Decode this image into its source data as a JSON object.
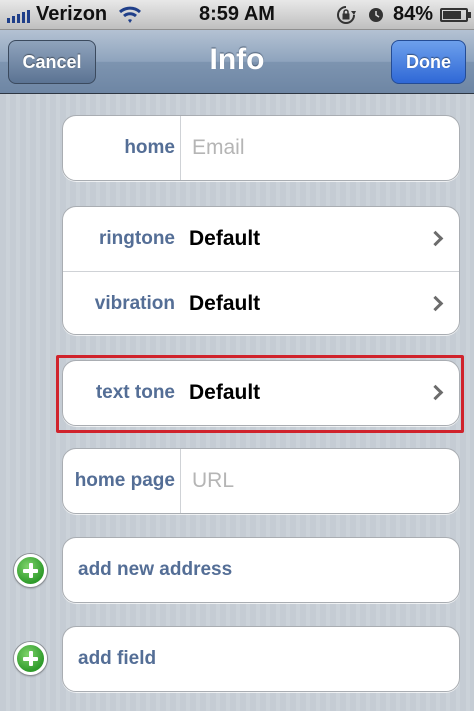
{
  "status_bar": {
    "carrier": "Verizon",
    "time": "8:59 AM",
    "battery_percent": "84%",
    "battery_level": 0.84,
    "icons": [
      "signal-icon",
      "wifi-icon",
      "rotation-lock-icon",
      "alarm-icon",
      "battery-icon"
    ]
  },
  "nav": {
    "title": "Info",
    "cancel_label": "Cancel",
    "done_label": "Done"
  },
  "email": {
    "label": "home",
    "placeholder": "Email"
  },
  "sounds": {
    "ringtone_label": "ringtone",
    "ringtone_value": "Default",
    "vibration_label": "vibration",
    "vibration_value": "Default"
  },
  "text_tone": {
    "label": "text tone",
    "value": "Default",
    "highlight_color": "#d0232c"
  },
  "url": {
    "label": "home page",
    "placeholder": "URL"
  },
  "add_address": {
    "label": "add new address"
  },
  "add_field": {
    "label": "add field"
  },
  "colors": {
    "nav_bar": "#7d94b0",
    "label": "#546e96",
    "done_button": "#2f68d6",
    "add_button": "#2f9b2b"
  }
}
